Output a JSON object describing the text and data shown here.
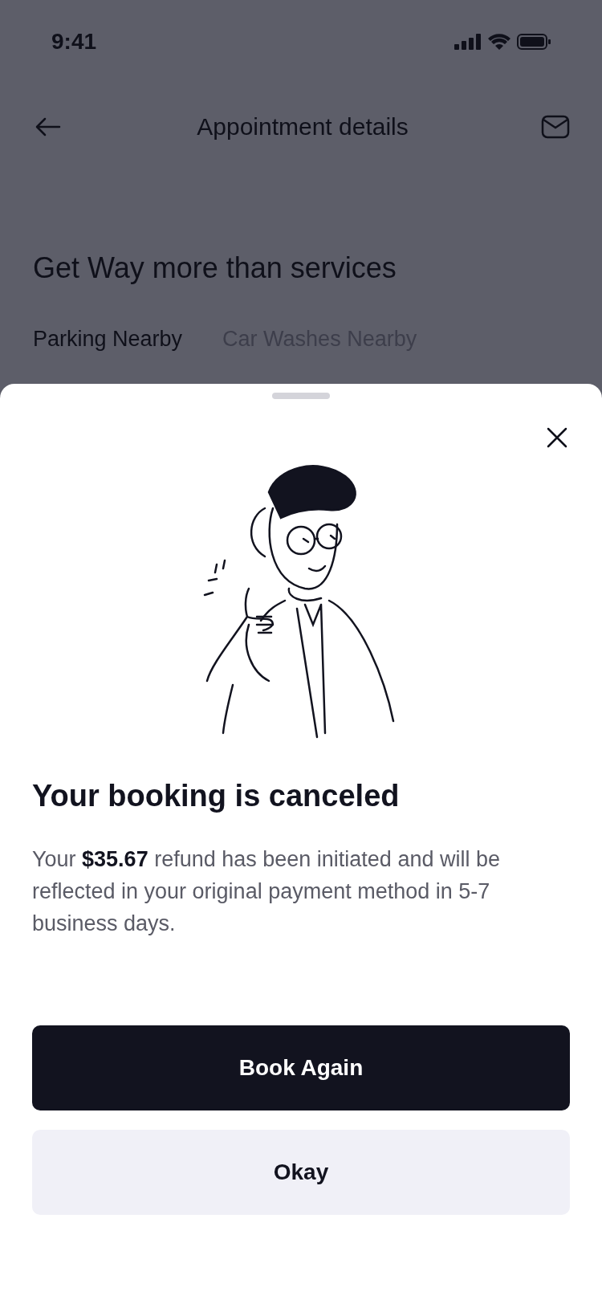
{
  "status_bar": {
    "time": "9:41"
  },
  "header": {
    "title": "Appointment details"
  },
  "section": {
    "title": "Get Way more than services"
  },
  "tabs": [
    {
      "label": "Parking Nearby",
      "selected": true
    },
    {
      "label": "Car Washes Nearby",
      "selected": false
    }
  ],
  "sheet": {
    "title": "Your booking is canceled",
    "message": "Your **$35.67** refund has been initiated and will be reflected in your original payment method in 5-7 business days.",
    "buttons": [
      {
        "label": "Book Again",
        "kind": "primary"
      },
      {
        "label": "Okay",
        "kind": "secondary"
      }
    ]
  }
}
